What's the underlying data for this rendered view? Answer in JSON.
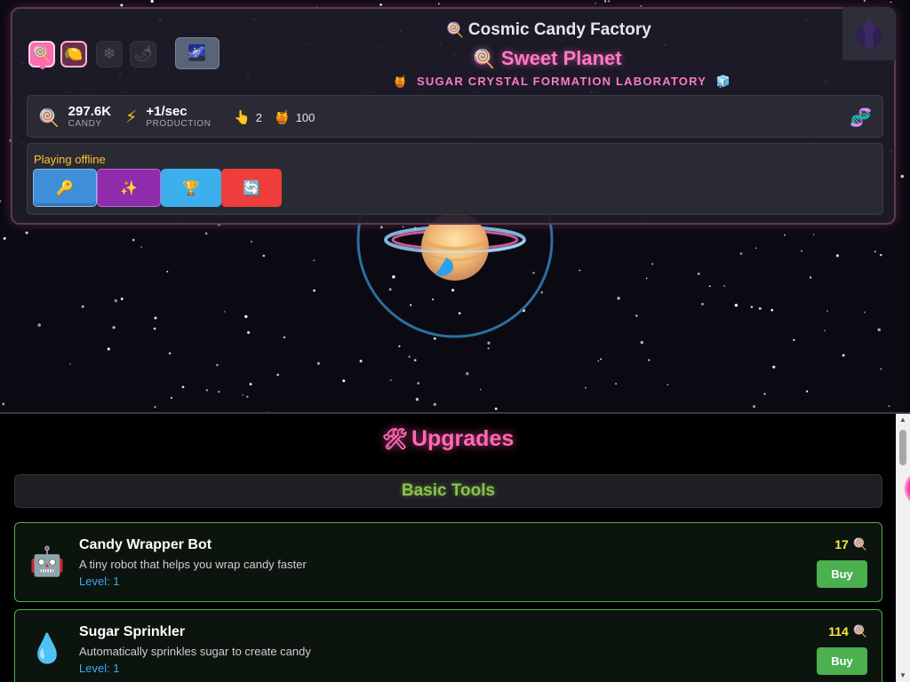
{
  "header": {
    "app_title": "Cosmic Candy Factory",
    "app_title_icon": "lollipop-icon",
    "planet_name": "Sweet Planet",
    "planet_icon": "lollipop-icon",
    "lab_subtitle": "SUGAR CRYSTAL FORMATION LABORATORY",
    "lab_subtitle_left_icon": "honey-pot-icon",
    "lab_subtitle_right_icon": "ice-cube-icon",
    "world_selector": [
      {
        "icon": "lollipop-icon",
        "state": "active"
      },
      {
        "icon": "lemon-icon",
        "state": "unlocked"
      },
      {
        "icon": "snowflake-icon",
        "state": "locked"
      },
      {
        "icon": "chili-pepper-icon",
        "state": "locked"
      }
    ],
    "galaxy_icon": "milky-way-icon",
    "crystal_icon": "purple-crystal-icon"
  },
  "stats": {
    "candy_value": "297.6K",
    "candy_label": "CANDY",
    "production_value": "+1/sec",
    "production_label": "PRODUCTION",
    "clicks_value": "2",
    "honey_value": "100",
    "dna_icon": "dna-icon"
  },
  "offline": {
    "status_text": "Playing offline",
    "buttons": [
      {
        "icon": "key-icon",
        "color": "#3f8ed8"
      },
      {
        "icon": "sparkles-icon",
        "color": "#8e2cab"
      },
      {
        "icon": "trophy-icon",
        "color": "#3cb0ec"
      },
      {
        "icon": "refresh-icon",
        "color": "#ee3d3a"
      }
    ]
  },
  "upgrades": {
    "title": "Upgrades",
    "title_icon": "hammer-and-wrench-icon",
    "category": "Basic Tools",
    "items": [
      {
        "icon": "robot-icon",
        "name": "Candy Wrapper Bot",
        "description": "A tiny robot that helps you wrap candy faster",
        "level": "Level: 1",
        "cost": "17",
        "buy_label": "Buy"
      },
      {
        "icon": "droplet-icon",
        "name": "Sugar Sprinkler",
        "description": "Automatically sprinkles sugar to create candy",
        "level": "Level: 1",
        "cost": "114",
        "buy_label": "Buy"
      }
    ]
  },
  "colors": {
    "accent_pink": "#ff79c6",
    "offline_yellow": "#ffc233",
    "upgrade_green": "#4caf50",
    "level_blue": "#3fa9f5",
    "cost_yellow": "#ffeb3b"
  }
}
